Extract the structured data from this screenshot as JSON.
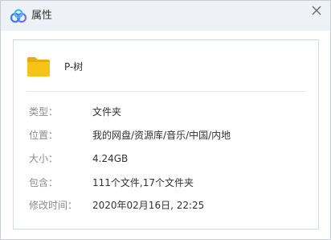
{
  "window": {
    "title": "属性",
    "icon": "baidu-netdisk-cloud-icon",
    "close_icon": "close-icon"
  },
  "item": {
    "icon": "folder-icon",
    "icon_color": "#f5c417",
    "name": "P-树"
  },
  "properties": [
    {
      "label": "类型：",
      "value": "文件夹"
    },
    {
      "label": "位置：",
      "value": "我的网盘/资源库/音乐/中国/内地"
    },
    {
      "label": "大小：",
      "value": "4.24GB"
    },
    {
      "label": "包含：",
      "value": "111个文件,17个文件夹"
    },
    {
      "label": "修改时间：",
      "value": "2020年02月16日, 22:25"
    }
  ],
  "colors": {
    "titlebar_bg": "#eef1f6",
    "label_text": "#8c8c8c",
    "value_text": "#333333",
    "brand_blue": "#2f7ff0",
    "brand_cyan": "#37c3f2",
    "brand_purple": "#7b6cf2"
  }
}
